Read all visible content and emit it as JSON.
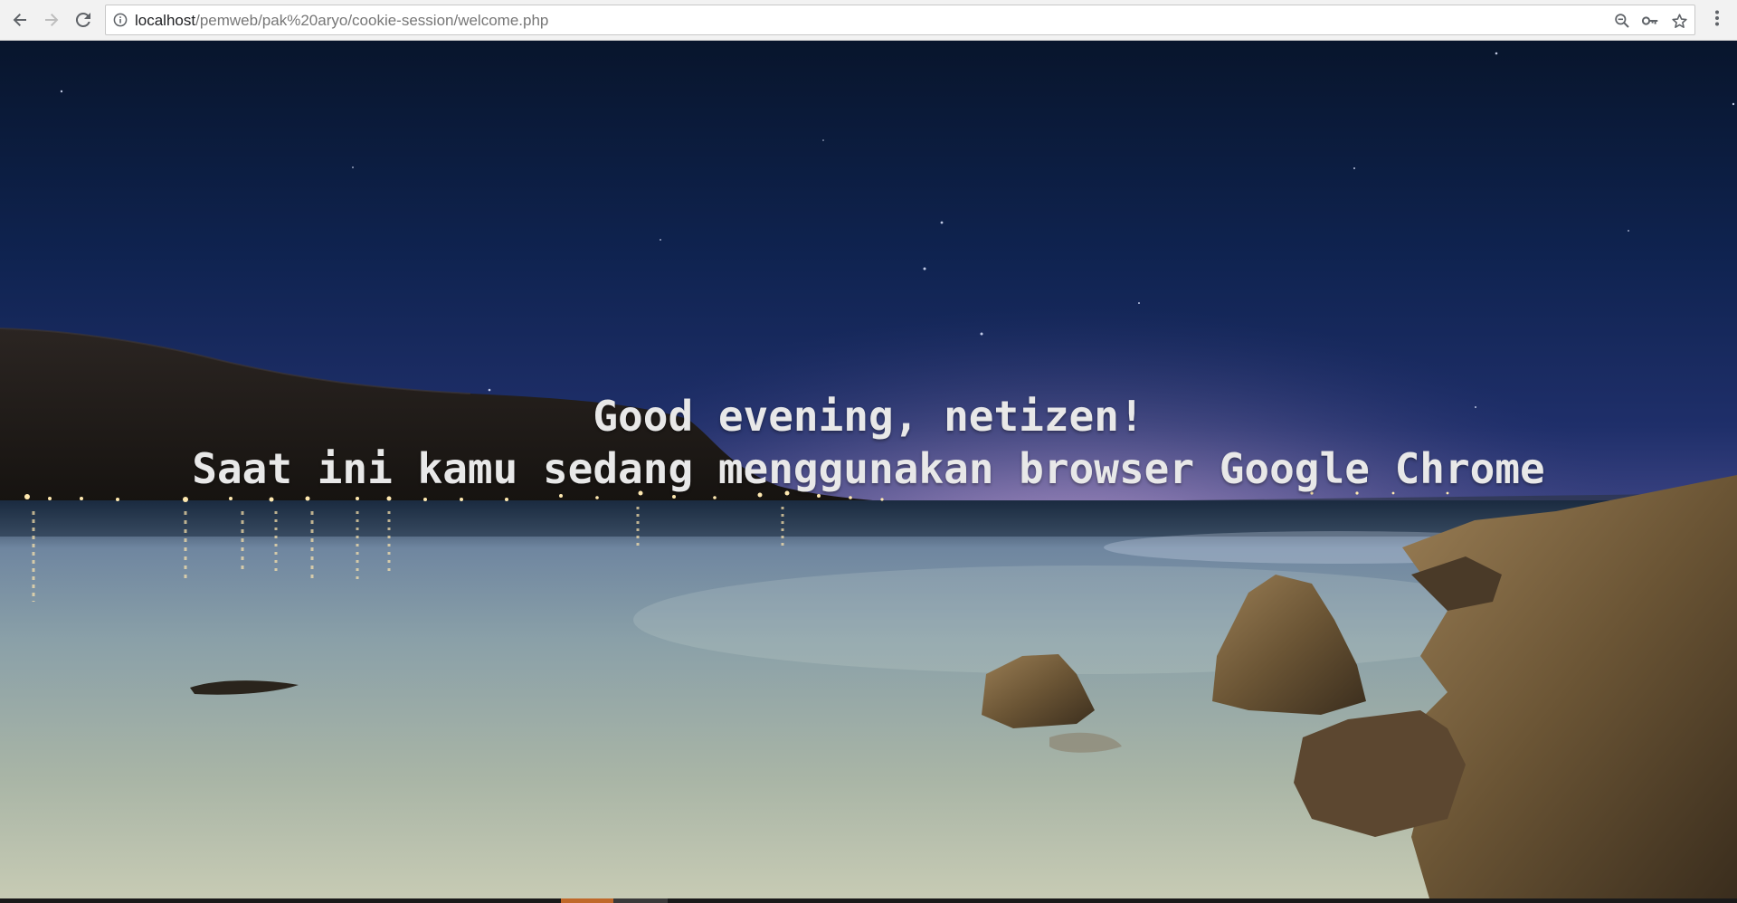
{
  "browser": {
    "url_host": "localhost",
    "url_path": "/pemweb/pak%20aryo/cookie-session/welcome.php",
    "icons": {
      "back": "arrow-left-icon",
      "forward": "arrow-right-icon",
      "reload": "reload-icon",
      "site_info": "info-icon",
      "zoom": "zoom-out-icon",
      "passwords": "key-icon",
      "bookmark": "star-icon",
      "menu": "kebab-menu-icon"
    }
  },
  "page": {
    "greeting_line1": "Good evening, netizen!",
    "greeting_line2": "Saat ini kamu sedang menggunakan browser Google Chrome"
  },
  "colors": {
    "toolbar_bg": "#f2f2f2",
    "text": "#e8e8e8",
    "sky_top": "#0b1a33",
    "horizon_glow": "#f3d7e6"
  }
}
